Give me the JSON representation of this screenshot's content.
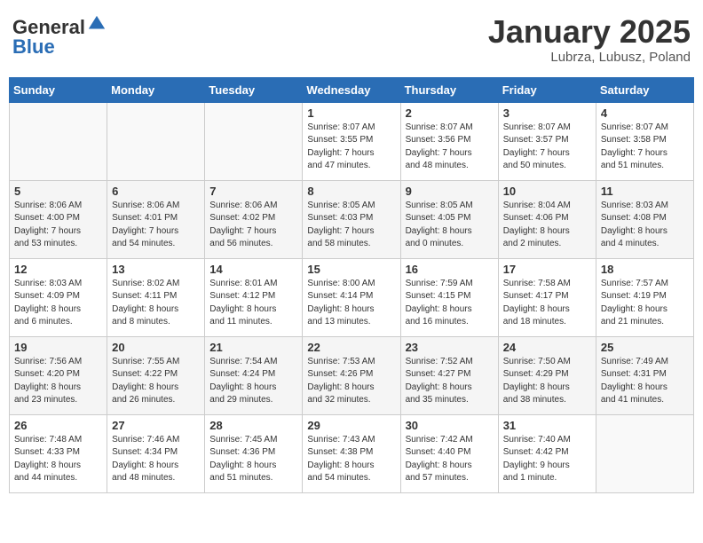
{
  "header": {
    "logo_general": "General",
    "logo_blue": "Blue",
    "month_year": "January 2025",
    "location": "Lubrza, Lubusz, Poland"
  },
  "days_of_week": [
    "Sunday",
    "Monday",
    "Tuesday",
    "Wednesday",
    "Thursday",
    "Friday",
    "Saturday"
  ],
  "weeks": [
    [
      {
        "day": "",
        "info": ""
      },
      {
        "day": "",
        "info": ""
      },
      {
        "day": "",
        "info": ""
      },
      {
        "day": "1",
        "info": "Sunrise: 8:07 AM\nSunset: 3:55 PM\nDaylight: 7 hours\nand 47 minutes."
      },
      {
        "day": "2",
        "info": "Sunrise: 8:07 AM\nSunset: 3:56 PM\nDaylight: 7 hours\nand 48 minutes."
      },
      {
        "day": "3",
        "info": "Sunrise: 8:07 AM\nSunset: 3:57 PM\nDaylight: 7 hours\nand 50 minutes."
      },
      {
        "day": "4",
        "info": "Sunrise: 8:07 AM\nSunset: 3:58 PM\nDaylight: 7 hours\nand 51 minutes."
      }
    ],
    [
      {
        "day": "5",
        "info": "Sunrise: 8:06 AM\nSunset: 4:00 PM\nDaylight: 7 hours\nand 53 minutes."
      },
      {
        "day": "6",
        "info": "Sunrise: 8:06 AM\nSunset: 4:01 PM\nDaylight: 7 hours\nand 54 minutes."
      },
      {
        "day": "7",
        "info": "Sunrise: 8:06 AM\nSunset: 4:02 PM\nDaylight: 7 hours\nand 56 minutes."
      },
      {
        "day": "8",
        "info": "Sunrise: 8:05 AM\nSunset: 4:03 PM\nDaylight: 7 hours\nand 58 minutes."
      },
      {
        "day": "9",
        "info": "Sunrise: 8:05 AM\nSunset: 4:05 PM\nDaylight: 8 hours\nand 0 minutes."
      },
      {
        "day": "10",
        "info": "Sunrise: 8:04 AM\nSunset: 4:06 PM\nDaylight: 8 hours\nand 2 minutes."
      },
      {
        "day": "11",
        "info": "Sunrise: 8:03 AM\nSunset: 4:08 PM\nDaylight: 8 hours\nand 4 minutes."
      }
    ],
    [
      {
        "day": "12",
        "info": "Sunrise: 8:03 AM\nSunset: 4:09 PM\nDaylight: 8 hours\nand 6 minutes."
      },
      {
        "day": "13",
        "info": "Sunrise: 8:02 AM\nSunset: 4:11 PM\nDaylight: 8 hours\nand 8 minutes."
      },
      {
        "day": "14",
        "info": "Sunrise: 8:01 AM\nSunset: 4:12 PM\nDaylight: 8 hours\nand 11 minutes."
      },
      {
        "day": "15",
        "info": "Sunrise: 8:00 AM\nSunset: 4:14 PM\nDaylight: 8 hours\nand 13 minutes."
      },
      {
        "day": "16",
        "info": "Sunrise: 7:59 AM\nSunset: 4:15 PM\nDaylight: 8 hours\nand 16 minutes."
      },
      {
        "day": "17",
        "info": "Sunrise: 7:58 AM\nSunset: 4:17 PM\nDaylight: 8 hours\nand 18 minutes."
      },
      {
        "day": "18",
        "info": "Sunrise: 7:57 AM\nSunset: 4:19 PM\nDaylight: 8 hours\nand 21 minutes."
      }
    ],
    [
      {
        "day": "19",
        "info": "Sunrise: 7:56 AM\nSunset: 4:20 PM\nDaylight: 8 hours\nand 23 minutes."
      },
      {
        "day": "20",
        "info": "Sunrise: 7:55 AM\nSunset: 4:22 PM\nDaylight: 8 hours\nand 26 minutes."
      },
      {
        "day": "21",
        "info": "Sunrise: 7:54 AM\nSunset: 4:24 PM\nDaylight: 8 hours\nand 29 minutes."
      },
      {
        "day": "22",
        "info": "Sunrise: 7:53 AM\nSunset: 4:26 PM\nDaylight: 8 hours\nand 32 minutes."
      },
      {
        "day": "23",
        "info": "Sunrise: 7:52 AM\nSunset: 4:27 PM\nDaylight: 8 hours\nand 35 minutes."
      },
      {
        "day": "24",
        "info": "Sunrise: 7:50 AM\nSunset: 4:29 PM\nDaylight: 8 hours\nand 38 minutes."
      },
      {
        "day": "25",
        "info": "Sunrise: 7:49 AM\nSunset: 4:31 PM\nDaylight: 8 hours\nand 41 minutes."
      }
    ],
    [
      {
        "day": "26",
        "info": "Sunrise: 7:48 AM\nSunset: 4:33 PM\nDaylight: 8 hours\nand 44 minutes."
      },
      {
        "day": "27",
        "info": "Sunrise: 7:46 AM\nSunset: 4:34 PM\nDaylight: 8 hours\nand 48 minutes."
      },
      {
        "day": "28",
        "info": "Sunrise: 7:45 AM\nSunset: 4:36 PM\nDaylight: 8 hours\nand 51 minutes."
      },
      {
        "day": "29",
        "info": "Sunrise: 7:43 AM\nSunset: 4:38 PM\nDaylight: 8 hours\nand 54 minutes."
      },
      {
        "day": "30",
        "info": "Sunrise: 7:42 AM\nSunset: 4:40 PM\nDaylight: 8 hours\nand 57 minutes."
      },
      {
        "day": "31",
        "info": "Sunrise: 7:40 AM\nSunset: 4:42 PM\nDaylight: 9 hours\nand 1 minute."
      },
      {
        "day": "",
        "info": ""
      }
    ]
  ]
}
